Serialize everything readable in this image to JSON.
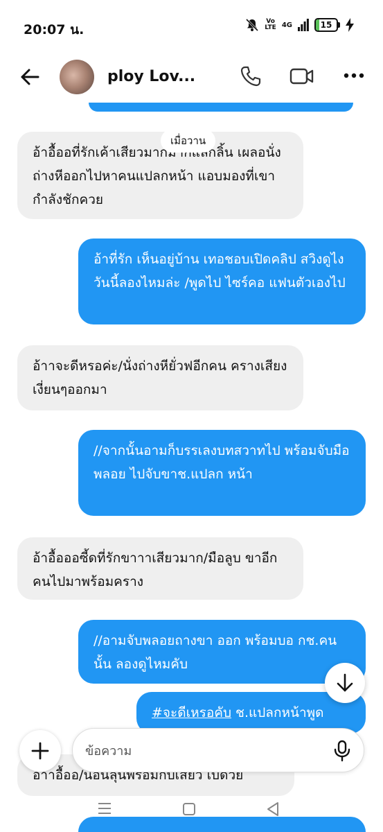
{
  "status": {
    "time": "20:07 น.",
    "volte_top": "Vo",
    "volte_bottom": "LTE",
    "network": "4G",
    "battery": "15",
    "battery_level": 0.15,
    "battery_color": "#5bc25b"
  },
  "header": {
    "contact_name": "ploy Lov..."
  },
  "chat": {
    "date_label": "เมื่อวาน",
    "messages": [
      {
        "side": "in",
        "text": "อ้าอื้ออที่รักเค้าเสียวมากมากแลกลิ้น เผลอนั่งถ่างหีออกไปหาคนแปลกหน้า แอบมองที่เขากำลังชักควย"
      },
      {
        "side": "out",
        "text": "อ้าที่รัก เห็นอยู่บ้าน เทอชอบเปิดคลิป สวิงดูไง วันนี้ลองไหมล่ะ /พูดไป ไซร์คอ แฟนตัวเองไป"
      },
      {
        "side": "in",
        "text": "อ้าาจะดีหรอค่ะ/นั่งถ่างหียั่วฟอีกคน ครางเสียงเงี่ยนๆออกมา"
      },
      {
        "side": "out",
        "text": "//จากนั้นอามก็บรรเลงบทสวาทไป พร้อมจับมือพลอย ไปจับขาช.แปลก หน้า"
      },
      {
        "side": "in",
        "text": "อ้าอื้อออซี้ดที่รักขาาาเสียวมาก/มือลูบ ขาอีกคนไปมาพร้อมคราง"
      },
      {
        "side": "out",
        "text": "//อามจับพลอยถางขา ออก พร้อมบอ กช.คนนั้น ลองดูไหมคับ"
      },
      {
        "side": "out",
        "hashtag": "#จะดีเหรอคับ",
        "text": " ช.แปลกหน้าพูด"
      },
      {
        "side": "in",
        "text": "อ้าาอื้ออ/นอนลุนพร้อมกับเสียว เบิดวย"
      },
      {
        "side": "out",
        "text": ""
      }
    ]
  },
  "composer": {
    "placeholder": "ข้อความ"
  },
  "colors": {
    "outgoing": "#2196f3",
    "incoming": "#efefef"
  }
}
